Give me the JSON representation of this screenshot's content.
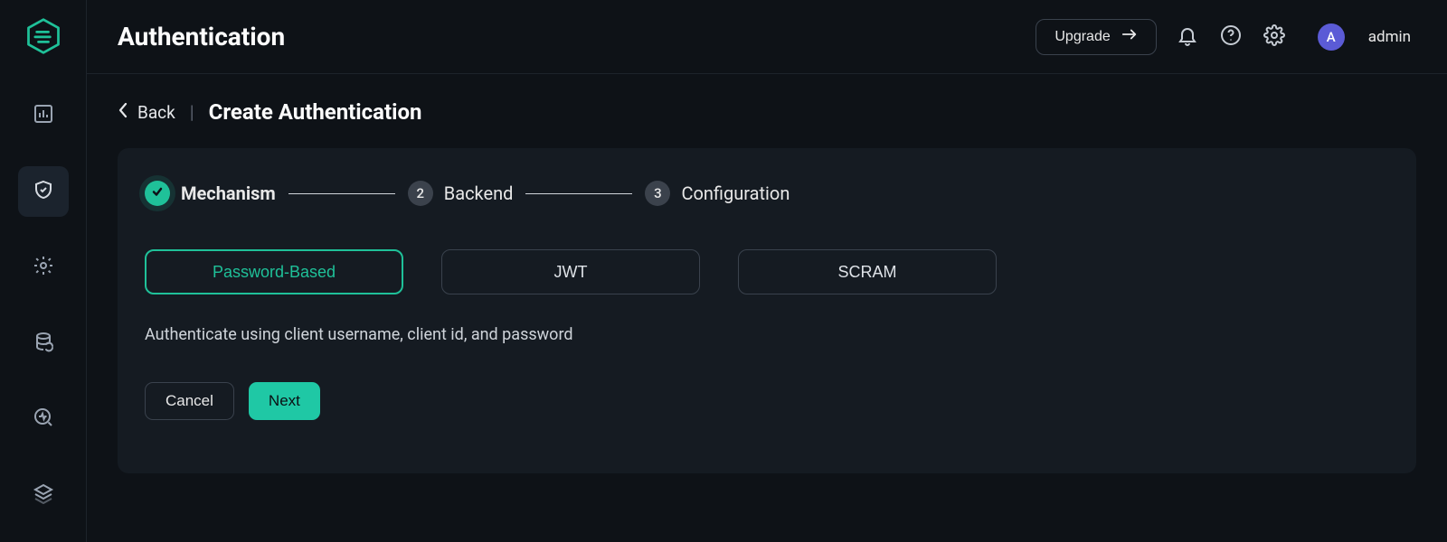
{
  "header": {
    "title": "Authentication",
    "upgrade_label": "Upgrade",
    "username": "admin",
    "avatar_initial": "A"
  },
  "breadcrumb": {
    "back_label": "Back",
    "page_subtitle": "Create Authentication"
  },
  "stepper": {
    "steps": [
      {
        "label": "Mechanism",
        "state": "done"
      },
      {
        "label": "Backend",
        "state": "pending",
        "num": "2"
      },
      {
        "label": "Configuration",
        "state": "pending",
        "num": "3"
      }
    ]
  },
  "options": [
    {
      "label": "Password-Based",
      "selected": true
    },
    {
      "label": "JWT",
      "selected": false
    },
    {
      "label": "SCRAM",
      "selected": false
    }
  ],
  "option_description": "Authenticate using client username, client id, and password",
  "actions": {
    "cancel": "Cancel",
    "next": "Next"
  },
  "sidebar": {
    "items": [
      {
        "name": "dashboard",
        "active": false
      },
      {
        "name": "security",
        "active": true
      },
      {
        "name": "integrations",
        "active": false
      },
      {
        "name": "data",
        "active": false
      },
      {
        "name": "diagnostics",
        "active": false
      },
      {
        "name": "cluster",
        "active": false
      }
    ]
  }
}
